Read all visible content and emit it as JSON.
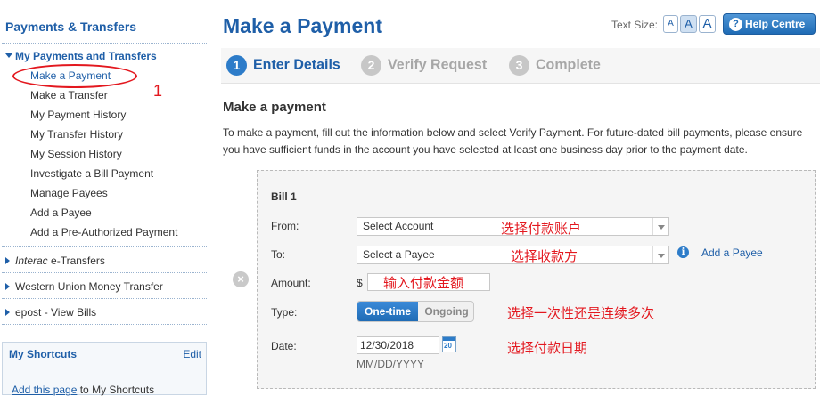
{
  "sidebar": {
    "title": "Payments & Transfers",
    "main_section": "My Payments and Transfers",
    "items": [
      "Make a Payment",
      "Make a Transfer",
      "My Payment History",
      "My Transfer History",
      "My Session History",
      "Investigate a Bill Payment",
      "Manage Payees",
      "Add a Payee",
      "Add a Pre-Authorized Payment"
    ],
    "interac_italic": "Interac",
    "interac_rest": " e-Transfers",
    "western_union": "Western Union Money Transfer",
    "epost": "epost - View Bills",
    "annotation_number": "1",
    "shortcuts": {
      "title": "My Shortcuts",
      "edit": "Edit",
      "add_link": "Add this page",
      "add_rest": " to My Shortcuts"
    }
  },
  "header": {
    "title": "Make a Payment",
    "text_size_label": "Text Size:",
    "text_size_buttons": [
      "A",
      "A",
      "A"
    ],
    "help": "Help Centre",
    "help_icon": "?"
  },
  "steps": [
    {
      "num": "1",
      "label": "Enter Details",
      "state": "active"
    },
    {
      "num": "2",
      "label": "Verify Request",
      "state": "inactive"
    },
    {
      "num": "3",
      "label": "Complete",
      "state": "inactive"
    }
  ],
  "section": {
    "title": "Make a payment",
    "intro": "To make a payment, fill out the information below and select Verify Payment. For future-dated bill payments, please ensure you have sufficient funds in the account you have selected at least one business day prior to the payment date."
  },
  "bill": {
    "title": "Bill 1",
    "from_label": "From:",
    "from_value": "Select Account",
    "to_label": "To:",
    "to_value": "Select a Payee",
    "add_payee": "Add a Payee",
    "amount_label": "Amount:",
    "currency": "$",
    "type_label": "Type:",
    "type_options": [
      "One-time",
      "Ongoing"
    ],
    "type_selected": "One-time",
    "date_label": "Date:",
    "date_value": "12/30/2018",
    "date_format": "MM/DD/YYYY",
    "calendar_day": "20",
    "remove_icon": "×"
  },
  "annotations": {
    "from": "选择付款账户",
    "to": "选择收款方",
    "amount": "输入付款金额",
    "type": "选择一次性还是连续多次",
    "date": "选择付款日期"
  },
  "colors": {
    "brand_blue": "#1f5fa8",
    "annotation_red": "#e3181f",
    "panel_bg": "#f5f5f5"
  }
}
